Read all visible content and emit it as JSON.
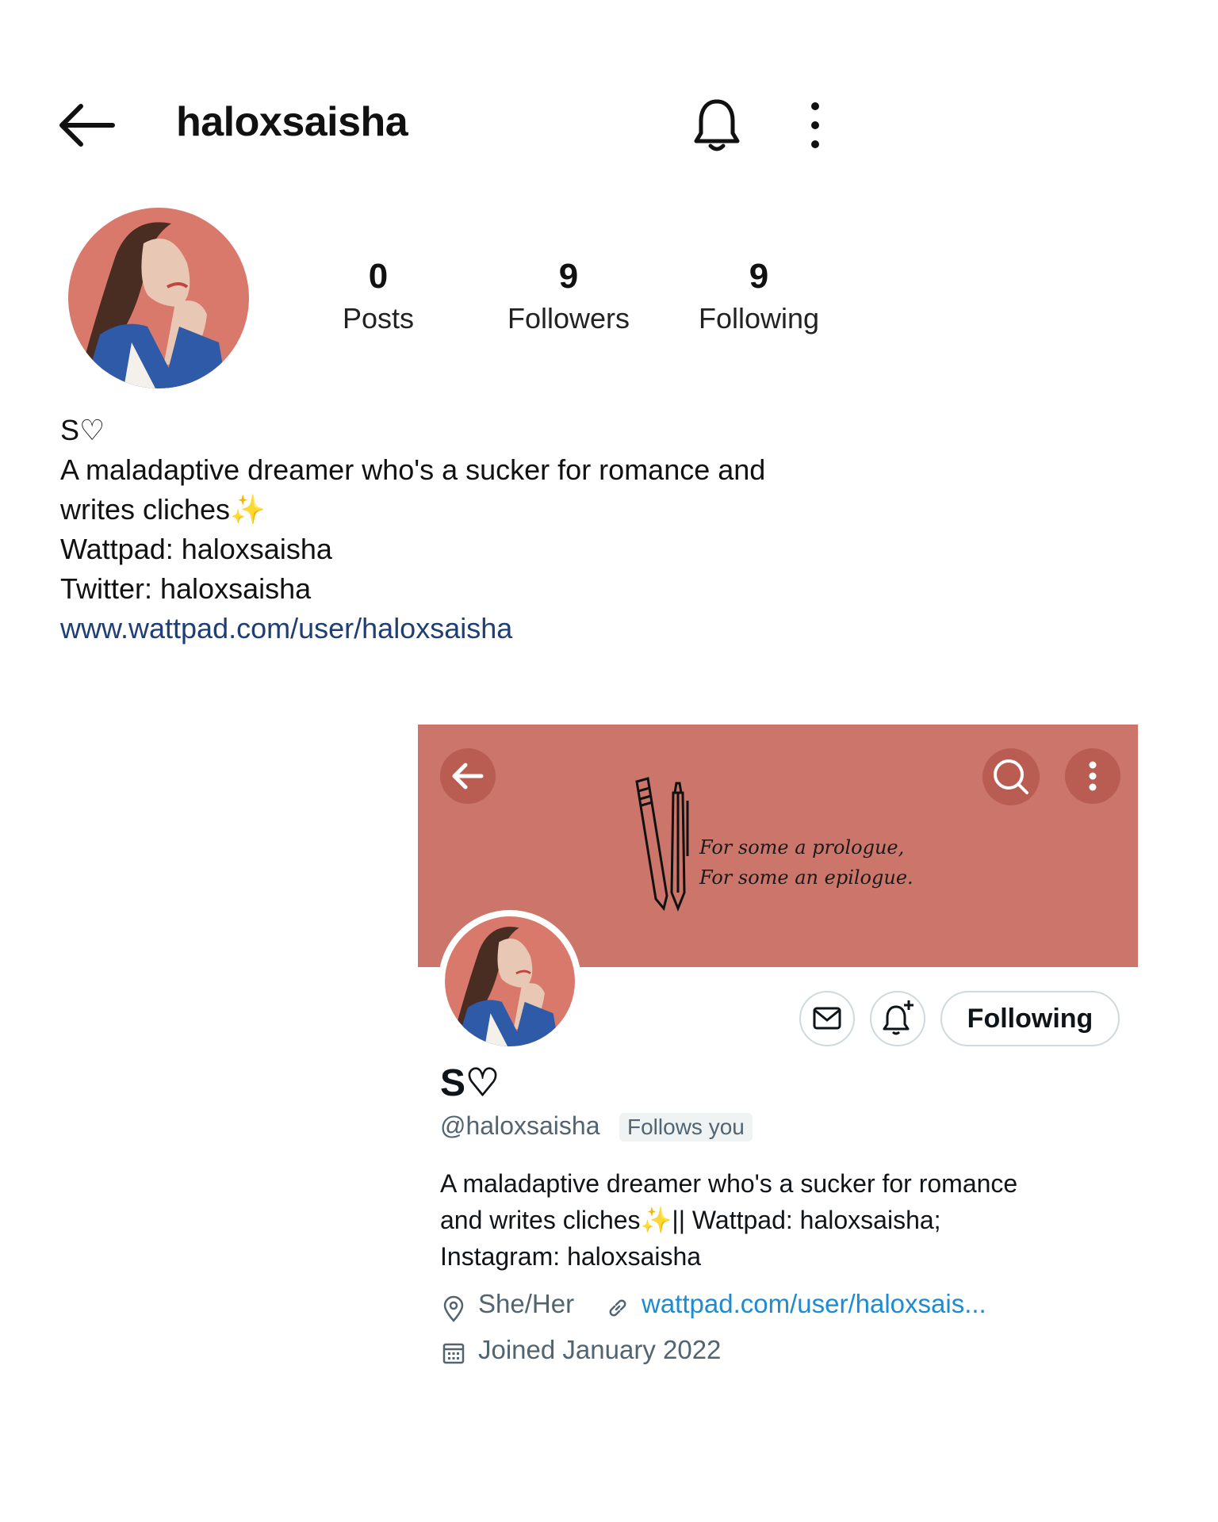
{
  "instagram": {
    "username": "haloxsaisha",
    "stats": [
      {
        "value": "0",
        "label": "Posts"
      },
      {
        "value": "9",
        "label": "Followers"
      },
      {
        "value": "9",
        "label": "Following"
      }
    ],
    "bio": {
      "name": "S♡",
      "line1": "A maladaptive dreamer who's a sucker for romance and",
      "line2": "writes cliches",
      "line2_emoji": "✨",
      "line3": "Wattpad: haloxsaisha",
      "line4": "Twitter: haloxsaisha",
      "link": "www.wattpad.com/user/haloxsaisha"
    }
  },
  "twitter": {
    "banner_text_line1": "For some a prologue,",
    "banner_text_line2": "For some an epilogue.",
    "following_button": "Following",
    "display_name": "S♡",
    "handle": "@haloxsaisha",
    "follows_you": "Follows you",
    "bio_line1": "A maladaptive dreamer who's a sucker for romance",
    "bio_line2_a": "and writes cliches",
    "bio_line2_emoji": "✨",
    "bio_line2_b": "|| Wattpad: haloxsaisha;",
    "bio_line3": "Instagram: haloxsaisha",
    "pronouns": "She/Her",
    "url": "wattpad.com/user/haloxsais...",
    "joined": "Joined January 2022"
  },
  "colors": {
    "banner": "#cc766b",
    "link_instagram": "#1f3e73",
    "link_twitter": "#1d8bd1",
    "avatar_bg": "#d9796c",
    "jacket": "#2f5aa8"
  },
  "icons": [
    "back-arrow-icon",
    "bell-icon",
    "more-vertical-icon",
    "search-icon",
    "mail-icon",
    "bell-plus-icon",
    "location-pin-icon",
    "link-icon",
    "calendar-icon",
    "pencil-icon"
  ]
}
